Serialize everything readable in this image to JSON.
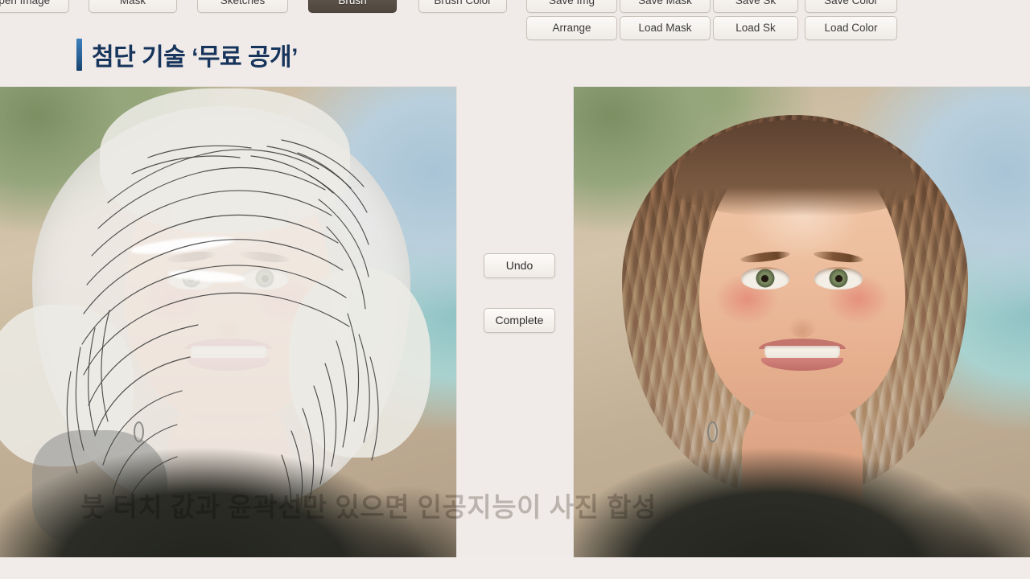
{
  "broadcast": {
    "headline": "첨단 기술 ‘무료 공개’",
    "subtitle": "붓 터치 값과 윤곽선만 있으면 인공지능이 사진 합성",
    "accent_color": "#2a6296",
    "headline_color": "#17355c",
    "background_color": "#f0ebe8"
  },
  "app": {
    "toolbar_left": [
      {
        "label": "Open Image",
        "active": false
      },
      {
        "label": "Mask",
        "active": false
      },
      {
        "label": "Sketches",
        "active": false
      },
      {
        "label": "Brush",
        "active": true
      },
      {
        "label": "Brush Color",
        "active": false
      }
    ],
    "toolbar_right_row1": [
      {
        "label": "Save Img"
      },
      {
        "label": "Save Mask"
      },
      {
        "label": "Save Sk"
      },
      {
        "label": "Save Color"
      }
    ],
    "toolbar_right_row2": [
      {
        "label": "Arrange"
      },
      {
        "label": "Load Mask"
      },
      {
        "label": "Load Sk"
      },
      {
        "label": "Load Color"
      }
    ],
    "center_actions": [
      {
        "label": "Undo"
      },
      {
        "label": "Complete"
      }
    ],
    "panels": {
      "left": {
        "name": "input-canvas",
        "description": "여성 인물 사진 위에 머리 영역이 흰색 마스크로 덮이고 검은 윤곽 스케치 선이 그려진 편집 캔버스"
      },
      "right": {
        "name": "result-canvas",
        "description": "인공지능이 스케치와 색 정보를 바탕으로 갈색 곱슬머리를 합성해 완성한 결과 이미지"
      }
    },
    "active_tool": "Brush"
  }
}
